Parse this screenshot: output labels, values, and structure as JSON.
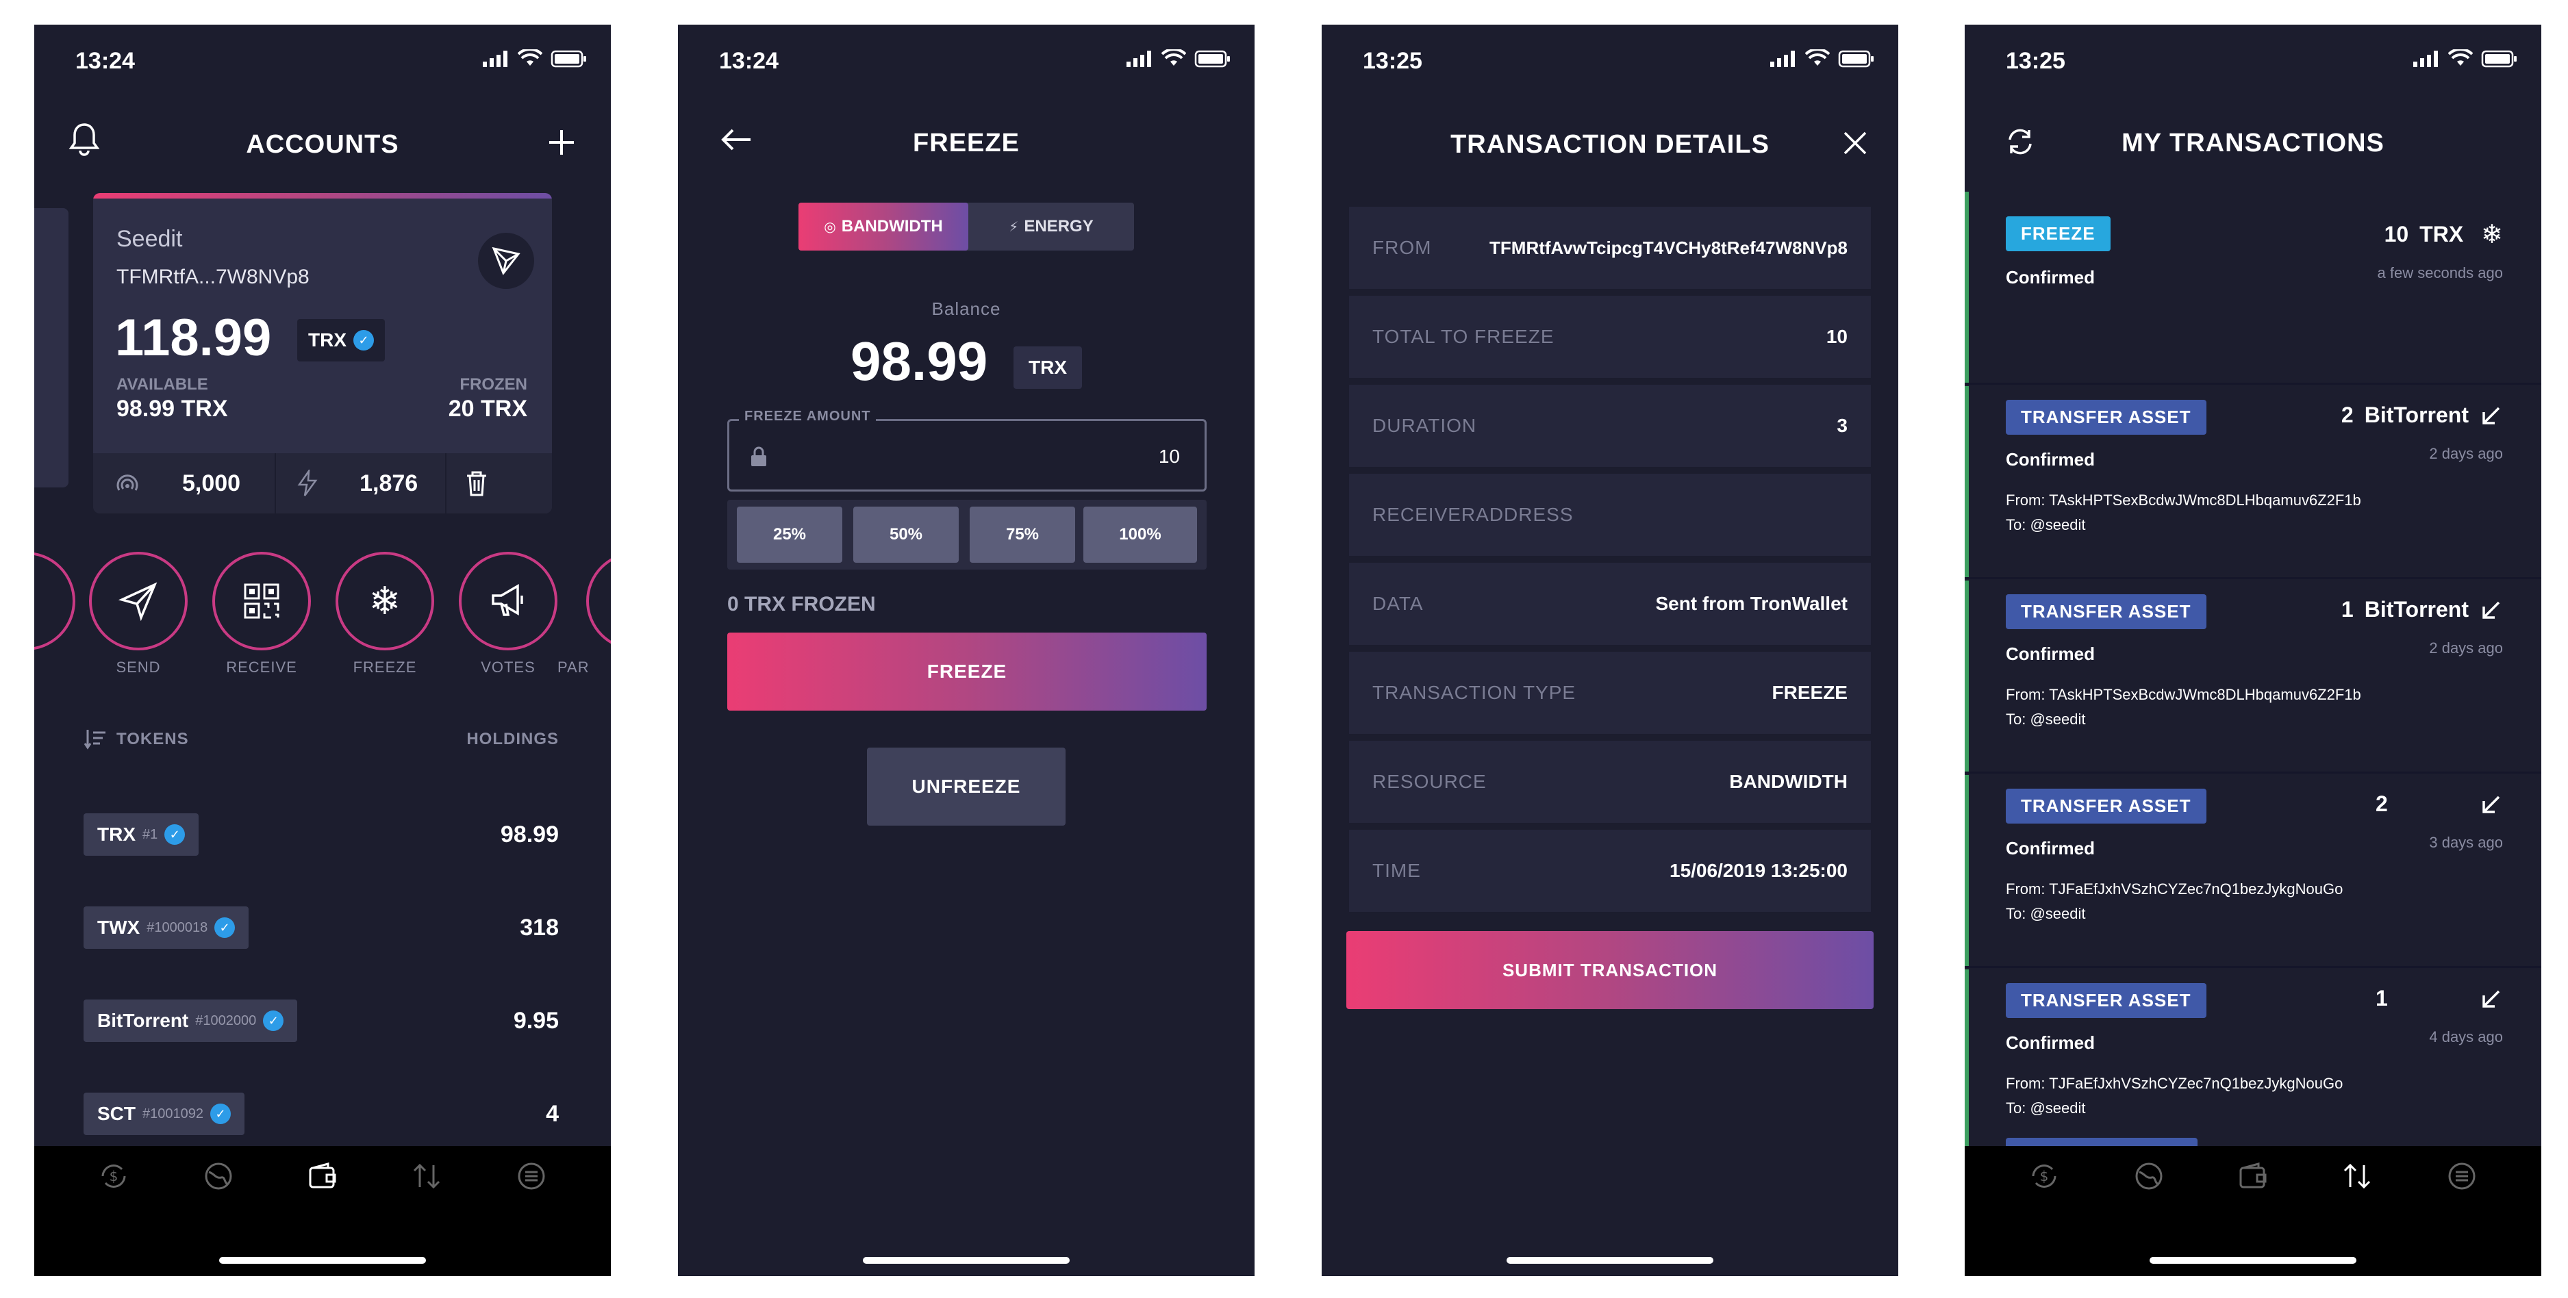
{
  "status": {
    "time1": "13:24",
    "time2": "13:24",
    "time3": "13:25",
    "time4": "13:25"
  },
  "accounts": {
    "title": "ACCOUNTS",
    "name": "Seedit",
    "address": "TFMRtfA...7W8NVp8",
    "balance": "118.99",
    "unit": "TRX",
    "available_label": "AVAILABLE",
    "available_value": "98.99 TRX",
    "frozen_label": "FROZEN",
    "frozen_value": "20 TRX",
    "bandwidth": "5,000",
    "energy": "1,876",
    "actions": [
      {
        "label": "SEND"
      },
      {
        "label": "RECEIVE"
      },
      {
        "label": "FREEZE"
      },
      {
        "label": "VOTES"
      },
      {
        "label": "PAR"
      }
    ],
    "tokens_header": "TOKENS",
    "holdings_header": "HOLDINGS",
    "tokens": [
      {
        "name": "TRX",
        "id": "#1",
        "value": "98.99"
      },
      {
        "name": "TWX",
        "id": "#1000018",
        "value": "318"
      },
      {
        "name": "BitTorrent",
        "id": "#1002000",
        "value": "9.95"
      },
      {
        "name": "SCT",
        "id": "#1001092",
        "value": "4"
      }
    ]
  },
  "freeze": {
    "title": "FREEZE",
    "tab_bandwidth": "BANDWIDTH",
    "tab_energy": "ENERGY",
    "balance_label": "Balance",
    "balance": "98.99",
    "unit": "TRX",
    "amount_label": "FREEZE AMOUNT",
    "amount_value": "10",
    "pcts": [
      "25%",
      "50%",
      "75%",
      "100%"
    ],
    "frozen_text": "0 TRX FROZEN",
    "freeze_button": "FREEZE",
    "unfreeze_button": "UNFREEZE"
  },
  "details": {
    "title": "TRANSACTION DETAILS",
    "rows": [
      {
        "label": "FROM",
        "value": "TFMRtfAvwTcipcgT4VCHy8tRef47W8NVp8"
      },
      {
        "label": "TOTAL TO FREEZE",
        "value": "10"
      },
      {
        "label": "DURATION",
        "value": "3"
      },
      {
        "label": "RECEIVERADDRESS",
        "value": ""
      },
      {
        "label": "DATA",
        "value": "Sent from TronWallet"
      },
      {
        "label": "TRANSACTION TYPE",
        "value": "FREEZE"
      },
      {
        "label": "RESOURCE",
        "value": "BANDWIDTH"
      },
      {
        "label": "TIME",
        "value": "15/06/2019 13:25:00"
      }
    ],
    "submit": "SUBMIT TRANSACTION"
  },
  "mytx": {
    "title": "MY TRANSACTIONS",
    "items": [
      {
        "badge": "FREEZE",
        "status": "Confirmed",
        "amount": "10",
        "asset": "TRX",
        "time": "a few seconds ago",
        "from": "",
        "to": ""
      },
      {
        "badge": "TRANSFER ASSET",
        "status": "Confirmed",
        "amount": "2",
        "asset": "BitTorrent",
        "time": "2 days ago",
        "from": "From: TAskHPTSexBcdwJWmc8DLHbqamuv6Z2F1b",
        "to": "To: @seedit"
      },
      {
        "badge": "TRANSFER ASSET",
        "status": "Confirmed",
        "amount": "1",
        "asset": "BitTorrent",
        "time": "2 days ago",
        "from": "From: TAskHPTSexBcdwJWmc8DLHbqamuv6Z2F1b",
        "to": "To: @seedit"
      },
      {
        "badge": "TRANSFER ASSET",
        "status": "Confirmed",
        "amount": "2",
        "asset": "",
        "time": "3 days ago",
        "from": "From: TJFaEfJxhVSzhCYZec7nQ1bezJykgNouGo",
        "to": "To: @seedit"
      },
      {
        "badge": "TRANSFER ASSET",
        "status": "Confirmed",
        "amount": "1",
        "asset": "",
        "time": "4 days ago",
        "from": "From: TJFaEfJxhVSzhCYZec7nQ1bezJykgNouGo",
        "to": "To: @seedit"
      }
    ]
  },
  "colors": {
    "bg": "#1c1d2e",
    "accent_pink": "#ea3d74",
    "accent_purple": "#6d4ea5",
    "freeze_badge": "#27a7de",
    "transfer_badge": "#4059a8"
  }
}
